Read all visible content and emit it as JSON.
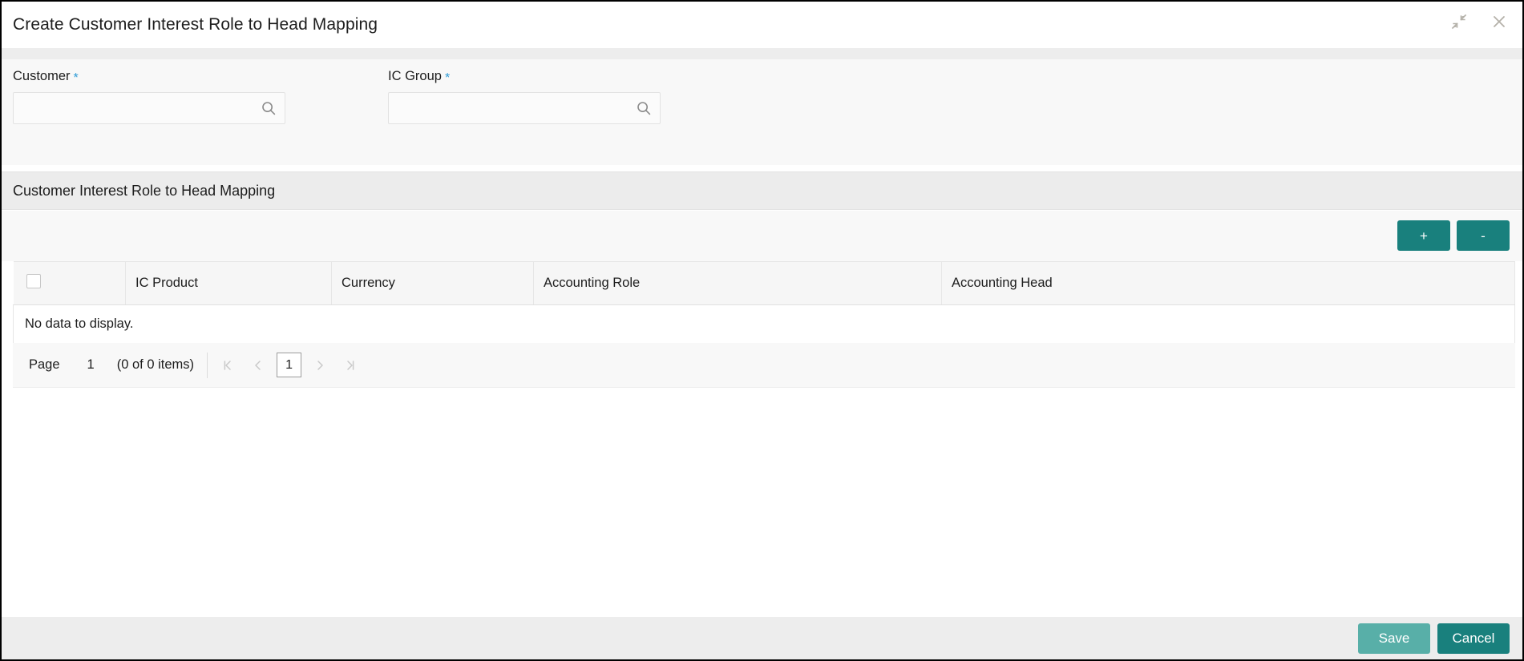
{
  "window": {
    "title": "Create Customer Interest Role to Head Mapping",
    "minimize_icon": "collapse-arrows-icon",
    "close_icon": "close-icon"
  },
  "form": {
    "fields": [
      {
        "label": "Customer",
        "required_marker": "*",
        "value": "",
        "placeholder": "",
        "icon": "search-icon"
      },
      {
        "label": "IC Group",
        "required_marker": "*",
        "value": "",
        "placeholder": "",
        "icon": "search-icon"
      }
    ]
  },
  "section": {
    "title": "Customer Interest Role to Head Mapping",
    "toolbar": {
      "add_label": "+",
      "remove_label": "-"
    }
  },
  "table": {
    "columns": [
      "IC Product",
      "Currency",
      "Accounting Role",
      "Accounting Head"
    ],
    "rows": [],
    "empty_message": "No data to display."
  },
  "pagination": {
    "page_label": "Page",
    "page_value": "1",
    "items_text": "(0 of 0 items)",
    "first_icon": "❙‹",
    "prev_icon": "‹",
    "current_page": "1",
    "next_icon": "›",
    "last_icon": "›❙"
  },
  "footer": {
    "save_label": "Save",
    "cancel_label": "Cancel"
  },
  "colors": {
    "accent_teal": "#19807d",
    "save_teal": "#58afa8",
    "required_blue": "#2e9bd6",
    "section_gray": "#ececec",
    "footer_gray": "#ededed"
  }
}
